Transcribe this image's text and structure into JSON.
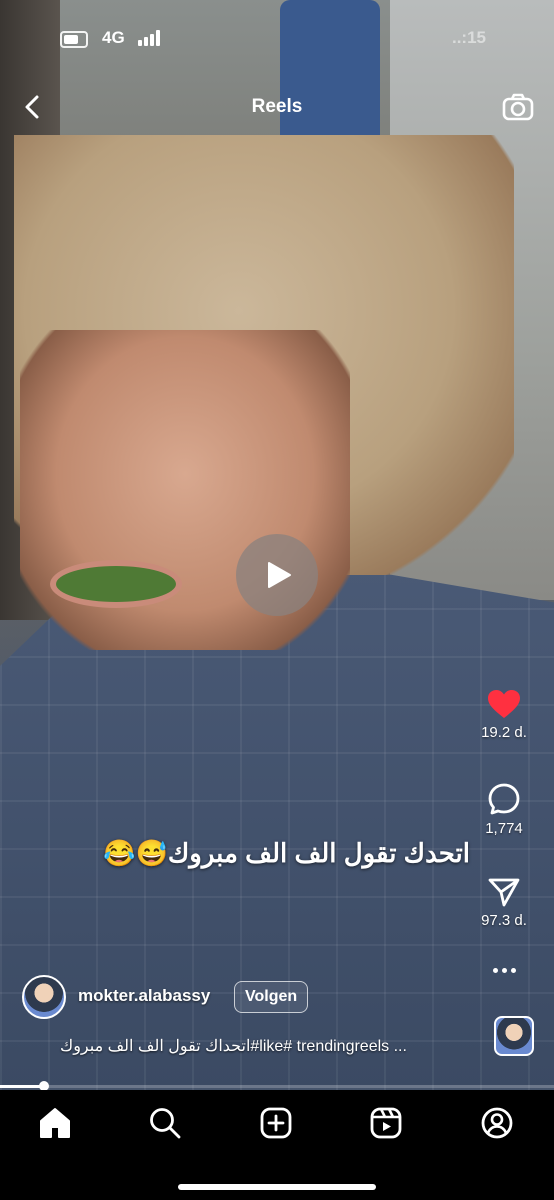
{
  "status_bar": {
    "network": "4G",
    "time": "..:15",
    "battery_icon": "battery-icon",
    "signal_icon": "signal-icon"
  },
  "top_nav": {
    "title": "Reels",
    "back_icon": "chevron-left-icon",
    "camera_icon": "camera-icon"
  },
  "video": {
    "caption_overlay": "اتحدك تقول الف الف مبروك😅😂",
    "play_icon": "play-icon",
    "progress": 0.08
  },
  "actions": {
    "like": {
      "icon": "heart-icon",
      "count": "19.2 d.",
      "color": "#ff3040",
      "liked": true
    },
    "comment": {
      "icon": "comment-icon",
      "count": "1,774"
    },
    "share": {
      "icon": "send-icon",
      "count": "97.3 d."
    },
    "more": {
      "icon": "more-dots-icon"
    }
  },
  "author": {
    "username": "mokter.alabassy",
    "follow_label": "Volgen"
  },
  "description": "اتحداك تقول الف الف مبروك#like# trendingreels ...",
  "bottom_nav": {
    "tabs": [
      {
        "icon": "home-icon",
        "active": true
      },
      {
        "icon": "search-icon"
      },
      {
        "icon": "create-icon"
      },
      {
        "icon": "reels-icon"
      },
      {
        "icon": "profile-icon"
      }
    ]
  }
}
